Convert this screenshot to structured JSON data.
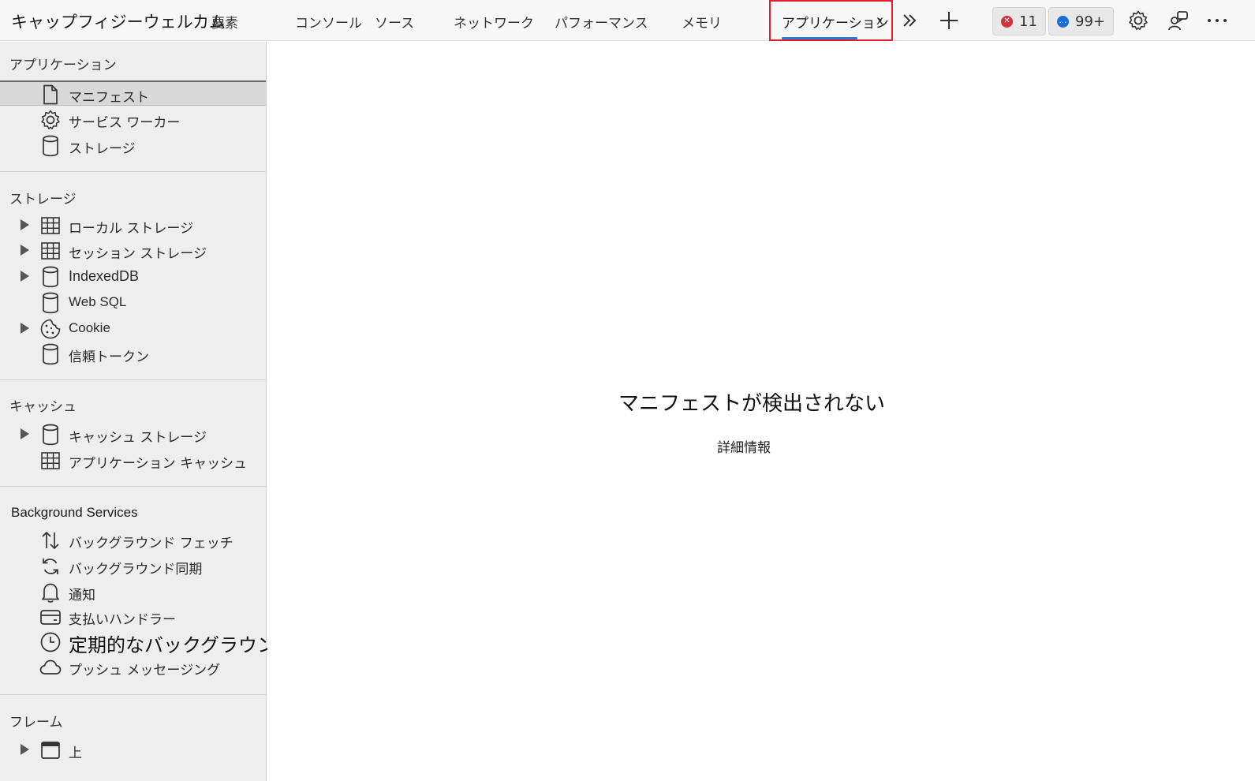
{
  "toolbar": {
    "app_title": "キャップフィジーウェルカム",
    "tabs": [
      {
        "label": "要素"
      },
      {
        "label": "コンソール"
      },
      {
        "label": "ソース"
      },
      {
        "label": "ネットワーク"
      },
      {
        "label": "パフォーマンス"
      },
      {
        "label": "メモリ"
      }
    ],
    "active_tab": {
      "label": "アプリケーション",
      "close": "x"
    },
    "errors_count": "11",
    "messages_count": "99+",
    "accent_color": "#2d7ad6",
    "highlight_color": "#e0212e",
    "error_color": "#d13438",
    "message_color": "#1a6ed8"
  },
  "sidebar": {
    "sections": [
      {
        "title": "アプリケーション",
        "items": [
          {
            "label": "マニフェスト",
            "icon": "document-icon",
            "selected": true
          },
          {
            "label": "サービス ワーカー",
            "icon": "gear-icon"
          },
          {
            "label": "ストレージ",
            "icon": "database-icon"
          }
        ]
      },
      {
        "title": "ストレージ",
        "items": [
          {
            "label": "ローカル ストレージ",
            "icon": "grid-icon",
            "expandable": true
          },
          {
            "label": "セッション ストレージ",
            "icon": "grid-icon",
            "expandable": true
          },
          {
            "label": "IndexedDB",
            "icon": "database-icon",
            "expandable": true
          },
          {
            "label": "Web SQL",
            "icon": "database-icon"
          },
          {
            "label": "Cookie",
            "icon": "cookie-icon",
            "expandable": true
          },
          {
            "label": "信頼トークン",
            "icon": "database-icon"
          }
        ]
      },
      {
        "title": "キャッシュ",
        "items": [
          {
            "label": "キャッシュ ストレージ",
            "icon": "database-icon",
            "expandable": true
          },
          {
            "label": "アプリケーション キャッシュ",
            "icon": "grid-icon"
          }
        ]
      },
      {
        "title": "Background Services",
        "items": [
          {
            "label": "バックグラウンド フェッチ",
            "icon": "up-down-arrows-icon"
          },
          {
            "label": "バックグラウンド同期",
            "icon": "sync-icon"
          },
          {
            "label": "通知",
            "icon": "bell-icon"
          },
          {
            "label": "支払いハンドラー",
            "icon": "card-icon"
          },
          {
            "label": "定期的なバックグラウンド同期",
            "icon": "clock-icon"
          },
          {
            "label": "プッシュ メッセージング",
            "icon": "cloud-icon"
          }
        ]
      },
      {
        "title": "フレーム",
        "items": [
          {
            "label": "上",
            "icon": "window-icon",
            "expandable": true
          }
        ]
      }
    ]
  },
  "main": {
    "title": "マニフェストが検出されない",
    "link": "詳細情報"
  }
}
